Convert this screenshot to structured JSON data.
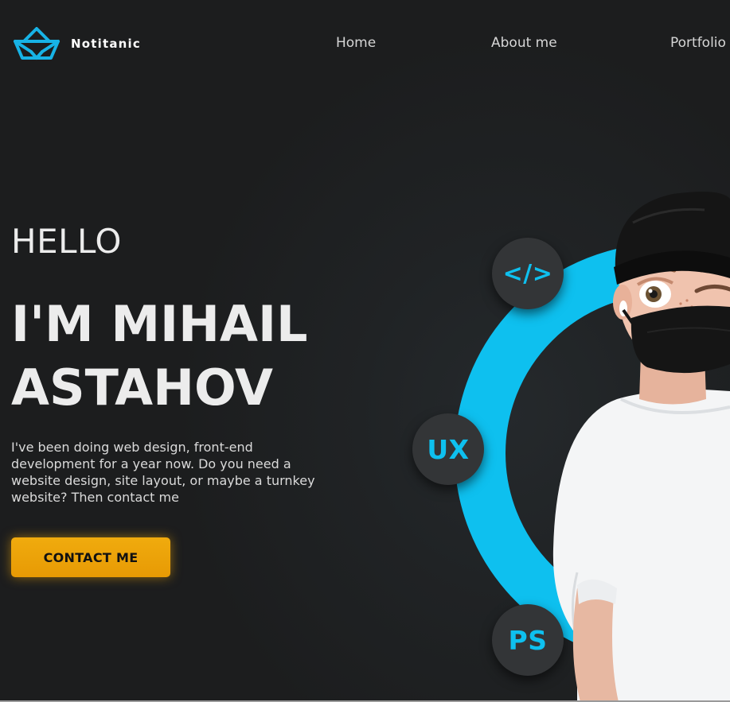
{
  "header": {
    "logo_text": "Notitanic",
    "logo_icon": "paper-boat-icon",
    "nav": [
      {
        "label": "Home"
      },
      {
        "label": "About me"
      },
      {
        "label": "Portfolio"
      }
    ]
  },
  "hero": {
    "greeting": "HELLO",
    "name_line1": "I'M MIHAIL",
    "name_line2": "ASTAHOV",
    "intro": "I've been doing web design, front-end development for a year now. Do you need a website design, site layout, or maybe a turnkey website? Then contact me",
    "cta_label": "CONTACT ME"
  },
  "skills": [
    {
      "label": "</>",
      "icon": "code-icon"
    },
    {
      "label": "UX"
    },
    {
      "label": "PS"
    }
  ],
  "colors": {
    "background": "#1c1d1e",
    "accent": "#0ec0ef",
    "button": "#eba106",
    "text": "#ececec"
  }
}
